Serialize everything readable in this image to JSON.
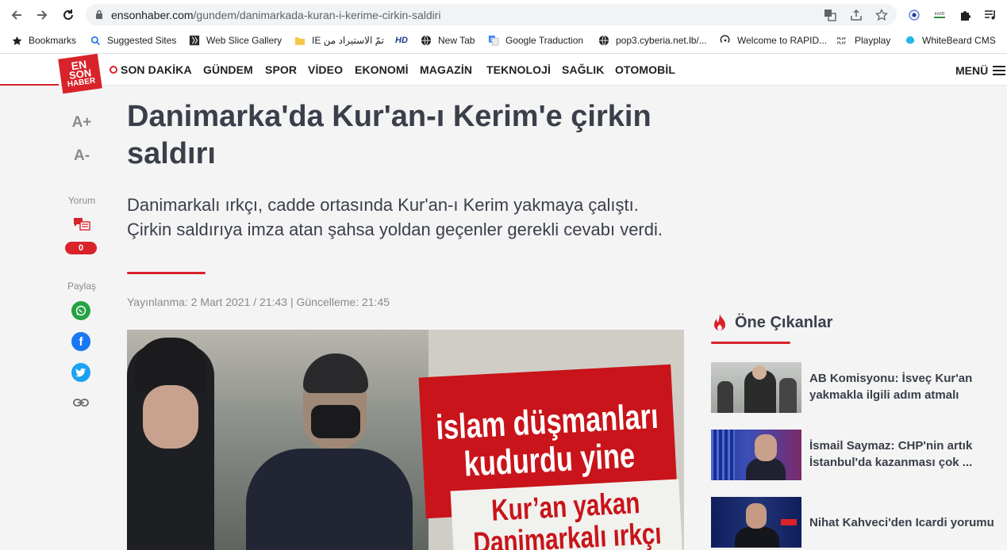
{
  "browser": {
    "url_host": "ensonhaber.com",
    "url_path": "/gundem/danimarkada-kuran-i-kerime-cirkin-saldiri",
    "bookmarks": [
      {
        "label": "Bookmarks",
        "icon": "star-icon"
      },
      {
        "label": "Suggested Sites",
        "icon": "search-icon"
      },
      {
        "label": "Web Slice Gallery",
        "icon": "web-slice-icon"
      },
      {
        "label": "IE تمّ الاستيراد من",
        "icon": "folder-icon"
      },
      {
        "label": "",
        "icon": "hd-icon"
      },
      {
        "label": "New Tab",
        "icon": "globe-icon"
      },
      {
        "label": "Google Traduction",
        "icon": "google-translate-icon"
      },
      {
        "label": "pop3.cyberia.net.lb/...",
        "icon": "globe-icon"
      },
      {
        "label": "Welcome to RAPID...",
        "icon": "rapid-icon"
      },
      {
        "label": "Playplay",
        "icon": "playplay-icon"
      },
      {
        "label": "WhiteBeard CMS",
        "icon": "whitebeard-icon"
      }
    ]
  },
  "site": {
    "logo": {
      "line1": "EN",
      "line2": "SON",
      "line3": "HABER"
    },
    "nav": [
      "SON DAKİKA",
      "GÜNDEM",
      "SPOR",
      "VİDEO",
      "EKONOMİ",
      "MAGAZİN",
      "TEKNOLOJİ",
      "SAĞLIK",
      "OTOMOBİL"
    ],
    "menu_label": "MENÜ",
    "accent_color": "#d8232a"
  },
  "tools": {
    "font_increase": "A+",
    "font_decrease": "A-",
    "comment_label": "Yorum",
    "comment_count": "0",
    "share_label": "Paylaş"
  },
  "article": {
    "title": "Danimarka'da Kur'an-ı Kerim'e çirkin saldırı",
    "summary": "Danimarkalı ırkçı, cadde ortasında Kur'an-ı Kerim yakmaya çalıştı. Çirkin saldırıya imza atan şahsa yoldan geçenler gerekli cevabı verdi.",
    "date": "Yayınlanma: 2 Mart 2021 / 21:43 | Güncelleme: 21:45",
    "image_text": {
      "banner_line1": "islam düşmanları",
      "banner_line2": "kudurdu yine",
      "banner2_line1": "Kur’an yakan",
      "banner2_line2": "Danimarkalı ırkçı"
    }
  },
  "sidebar": {
    "heading": "Öne Çıkanlar",
    "items": [
      {
        "title": "AB Komisyonu: İsveç Kur'an yakmakla ilgili adım atmalı"
      },
      {
        "title": "İsmail Saymaz: CHP'nin artık İstanbul'da kazanması çok ..."
      },
      {
        "title": "Nihat Kahveci'den Icardi yorumu"
      }
    ]
  }
}
